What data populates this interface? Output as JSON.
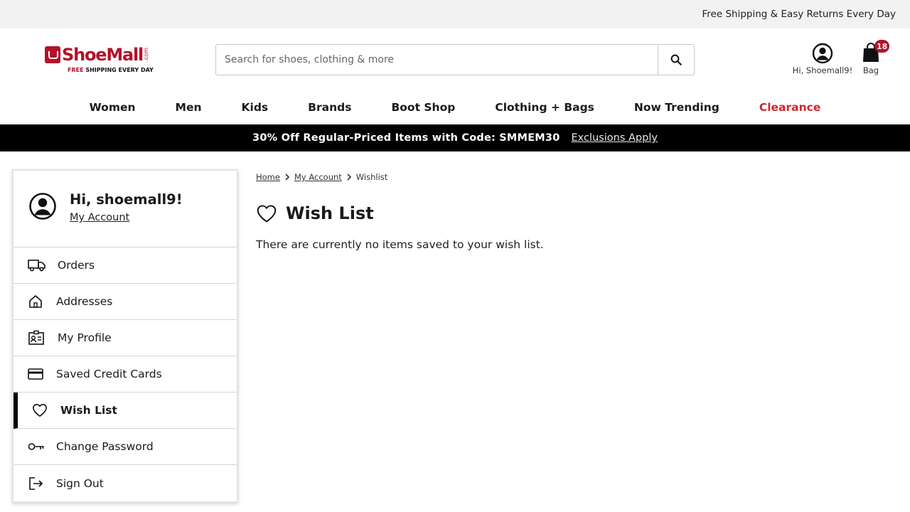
{
  "topbar": {
    "text": "Free Shipping & Easy Returns Every Day"
  },
  "logo": {
    "name": "ShoeMall",
    "dotcom": ".com",
    "tag_free": "FREE",
    "tag_rest": " SHIPPING EVERY DAY"
  },
  "search": {
    "placeholder": "Search for shoes, clothing & more",
    "value": ""
  },
  "account": {
    "label": "Hi, Shoemall9!"
  },
  "bag": {
    "label": "Bag",
    "count": "18"
  },
  "nav": {
    "women": "Women",
    "men": "Men",
    "kids": "Kids",
    "brands": "Brands",
    "boot_shop": "Boot Shop",
    "clothing_bags": "Clothing + Bags",
    "now_trending": "Now Trending",
    "clearance": "Clearance"
  },
  "promo": {
    "text": "30% Off Regular-Priced Items with Code: SMMEM30",
    "link": "Exclusions Apply"
  },
  "sidebar": {
    "greeting": "Hi, shoemall9!",
    "my_account": "My Account",
    "items": [
      {
        "label": "Orders",
        "icon": "truck-icon"
      },
      {
        "label": "Addresses",
        "icon": "home-icon"
      },
      {
        "label": "My Profile",
        "icon": "id-card-icon"
      },
      {
        "label": "Saved Credit Cards",
        "icon": "credit-card-icon"
      },
      {
        "label": "Wish List",
        "icon": "heart-icon",
        "active": true
      },
      {
        "label": "Change Password",
        "icon": "key-icon"
      },
      {
        "label": "Sign Out",
        "icon": "sign-out-icon"
      }
    ]
  },
  "breadcrumb": {
    "home": "Home",
    "account": "My Account",
    "current": "Wishlist"
  },
  "page": {
    "title": "Wish List",
    "empty_message": "There are currently no items saved to your wish list."
  },
  "colors": {
    "brand": "#b3122a",
    "clearance": "#d1272d",
    "promo_bg": "#000000"
  }
}
